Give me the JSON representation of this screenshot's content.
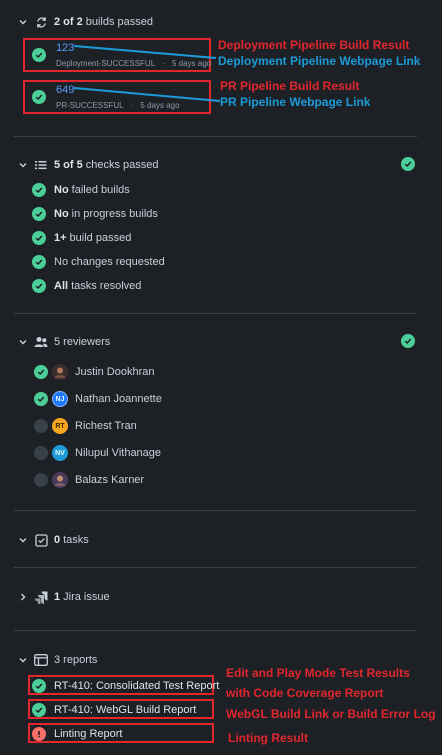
{
  "builds": {
    "summary_count": "2 of 2",
    "summary_label": "builds passed",
    "items": [
      {
        "number": "123",
        "status": "Deployment-SUCCESSFUL",
        "age": "5 days ago"
      },
      {
        "number": "649",
        "status": "PR-SUCCESSFUL",
        "age": "5 days ago"
      }
    ],
    "meta_separator": "·"
  },
  "annotations": {
    "deploy_result": "Deployment Pipeline Build Result",
    "deploy_link": "Deployment Pipeline Webpage Link",
    "pr_result": "PR Pipeline Build Result",
    "pr_link": "PR Pipeline Webpage Link",
    "edit_play_line1": "Edit and Play Mode Test Results",
    "edit_play_line2": "with Code Coverage Report",
    "webgl": "WebGL Build Link or Build Error Log",
    "linting": "Linting Result"
  },
  "checks": {
    "summary_count": "5 of 5",
    "summary_label": "checks passed",
    "items": [
      {
        "bold": "No",
        "text": "failed builds"
      },
      {
        "bold": "No",
        "text": "in progress builds"
      },
      {
        "bold": "1+",
        "text": "build passed"
      },
      {
        "bold": "",
        "text": "No changes requested"
      },
      {
        "bold": "All",
        "text": "tasks resolved"
      }
    ]
  },
  "reviewers": {
    "summary": "5 reviewers",
    "items": [
      {
        "name": "Justin Dookhran",
        "approved": true,
        "initials": "",
        "color": "#6b4a3a"
      },
      {
        "name": "Nathan Joannette",
        "approved": true,
        "initials": "NJ",
        "color": "#1d7afc"
      },
      {
        "name": "Richest Tran",
        "approved": false,
        "initials": "RT",
        "color": "#f5a623"
      },
      {
        "name": "Nilupul Vithanage",
        "approved": false,
        "initials": "NV",
        "color": "#1d9bd8"
      },
      {
        "name": "Balazs Karner",
        "approved": false,
        "initials": "",
        "color": "#5a4a6a"
      }
    ]
  },
  "tasks": {
    "count": "0",
    "label": "tasks"
  },
  "jira": {
    "count": "1",
    "label": "Jira issue"
  },
  "reports": {
    "summary": "3 reports",
    "items": [
      {
        "name": "RT-410: Consolidated Test Report",
        "status": "success"
      },
      {
        "name": "RT-410: WebGL Build Report",
        "status": "success"
      },
      {
        "name": "Linting Report",
        "status": "error"
      }
    ]
  },
  "colors": {
    "success": "#4bce97",
    "error": "#f87168",
    "link": "#579dff",
    "annotation_red": "#e2262e",
    "annotation_blue": "#1d9bd8"
  }
}
